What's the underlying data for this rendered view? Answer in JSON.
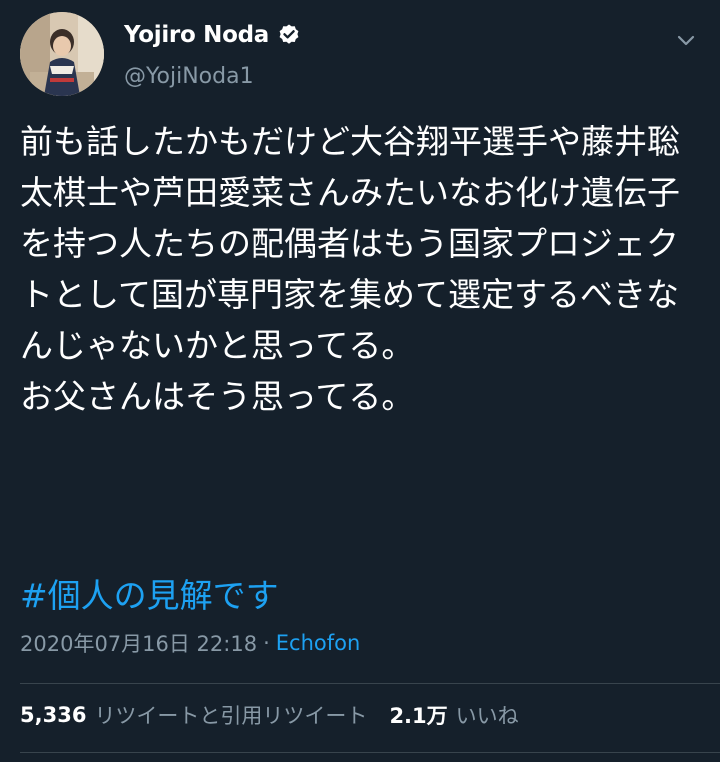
{
  "profile": {
    "display_name": "Yojiro Noda",
    "handle": "@YojiNoda1",
    "verified": true
  },
  "tweet": {
    "text": "前も話したかもだけど大谷翔平選手や藤井聡太棋士や芦田愛菜さんみたいなお化け遺伝子を持つ人たちの配偶者はもう国家プロジェクトとして国が専門家を集めて選定するべきなんじゃないかと思ってる。\nお父さんはそう思ってる。",
    "hashtag": "#個人の見解です",
    "timestamp": "2020年07月16日 22:18",
    "separator": "·",
    "source": "Echofon"
  },
  "stats": {
    "retweets_count": "5,336",
    "retweets_label": "リツイートと引用リツイート",
    "likes_count": "2.1万",
    "likes_label": "いいね"
  },
  "icons": {
    "verified": "verified-badge-icon",
    "menu": "chevron-down-icon"
  },
  "colors": {
    "background": "#15202b",
    "accent": "#1da1f2",
    "secondary_text": "#8899a6",
    "divider": "#38444d"
  }
}
